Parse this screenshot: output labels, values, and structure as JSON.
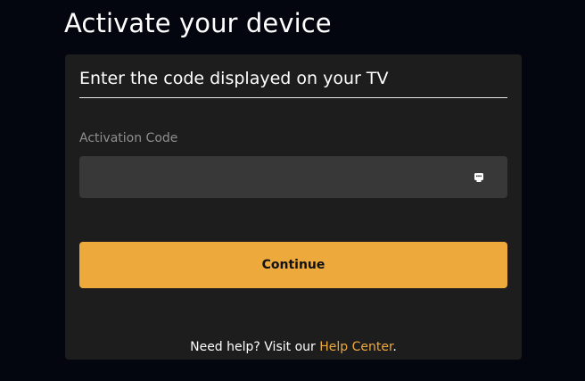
{
  "page": {
    "title": "Activate your device"
  },
  "card": {
    "heading": "Enter the code displayed on your TV",
    "activation_field": {
      "label": "Activation Code",
      "value": "",
      "placeholder": "",
      "trailing_icon": "password-autofill-icon"
    },
    "continue_label": "Continue",
    "help": {
      "prefix": "Need help? Visit our ",
      "link_text": "Help Center",
      "suffix": "."
    }
  },
  "colors": {
    "background": "#04060f",
    "card": "#1d1d1d",
    "input": "#383838",
    "accent": "#eea93d",
    "label": "#8e8e8e"
  }
}
